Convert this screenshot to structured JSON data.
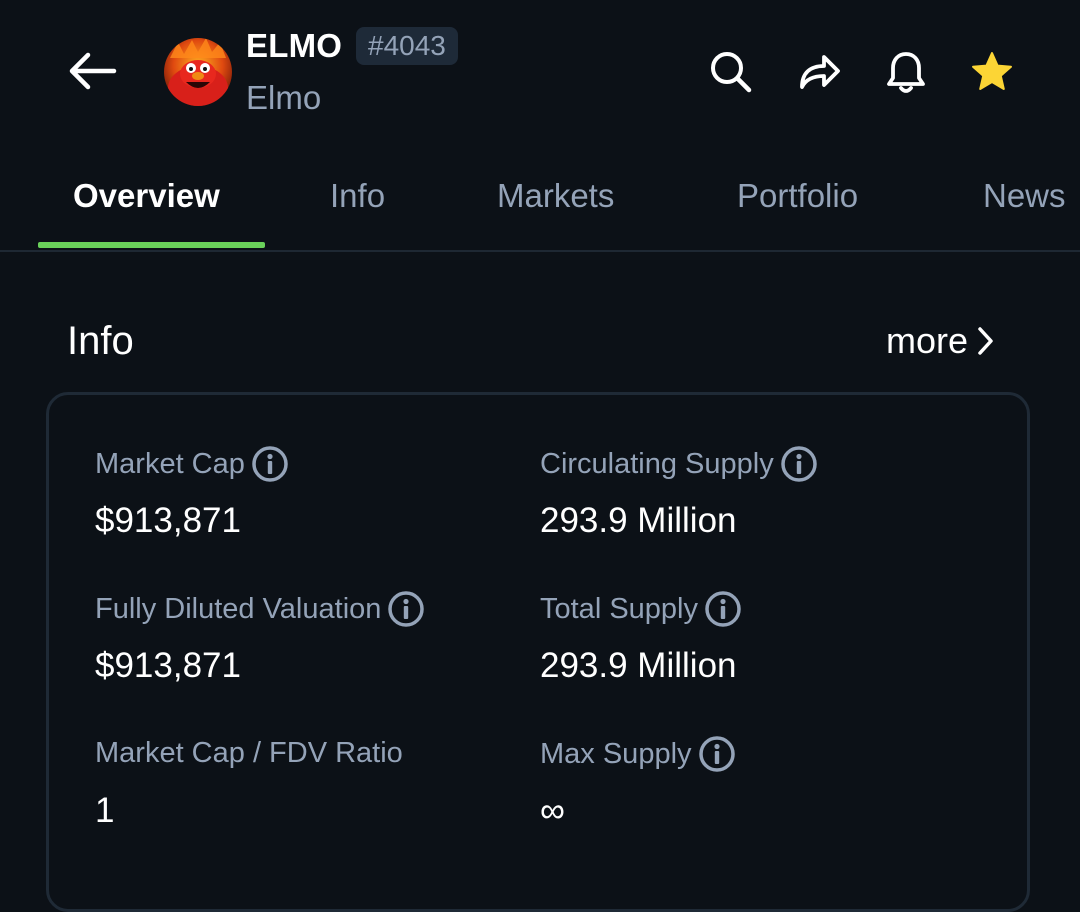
{
  "header": {
    "symbol": "ELMO",
    "rank": "#4043",
    "name": "Elmo",
    "icons": [
      "back-arrow-icon",
      "search-icon",
      "share-icon",
      "bell-icon",
      "star-icon"
    ],
    "star_color": "#fcd535"
  },
  "tabs": [
    {
      "label": "Overview",
      "active": true
    },
    {
      "label": "Info",
      "active": false
    },
    {
      "label": "Markets",
      "active": false
    },
    {
      "label": "Portfolio",
      "active": false
    },
    {
      "label": "News",
      "active": false
    }
  ],
  "accent_color": "#6ad15a",
  "info": {
    "title": "Info",
    "more_label": "more",
    "stats": [
      {
        "label": "Market Cap",
        "value": "$913,871",
        "has_info": true
      },
      {
        "label": "Circulating Supply",
        "value": "293.9 Million",
        "has_info": true
      },
      {
        "label": "Fully Diluted Valuation",
        "value": "$913,871",
        "has_info": true
      },
      {
        "label": "Total Supply",
        "value": "293.9 Million",
        "has_info": true
      },
      {
        "label": "Market Cap / FDV Ratio",
        "value": "1",
        "has_info": false
      },
      {
        "label": "Max Supply",
        "value": "∞",
        "has_info": true
      }
    ]
  }
}
